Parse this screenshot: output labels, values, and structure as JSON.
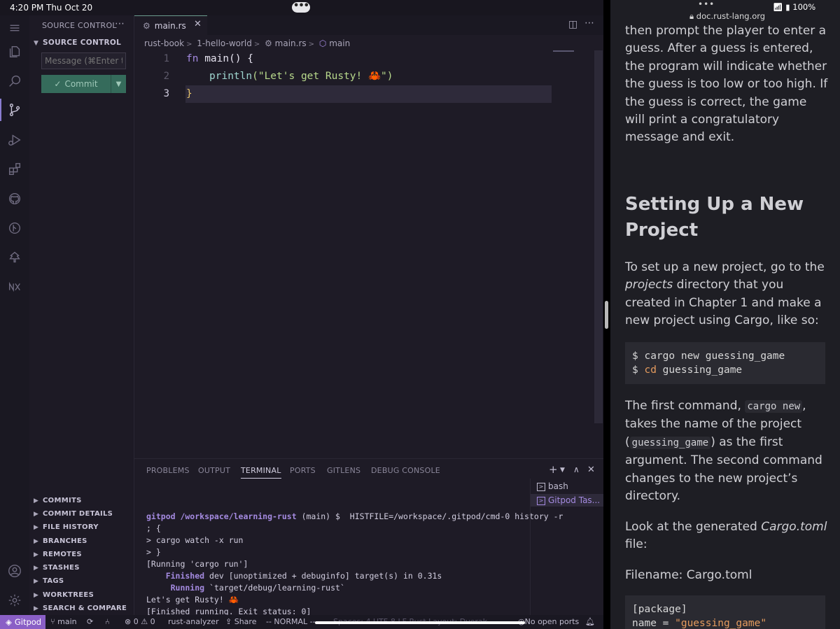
{
  "ipad": {
    "time": "4:20 PM",
    "date": "Thu Oct 20",
    "battery": "100%"
  },
  "sidebar": {
    "title": "SOURCE CONTROL",
    "more": "⋯",
    "section_header": "SOURCE CONTROL",
    "message_placeholder": "Message (⌘Enter t...",
    "commit_label": "Commit",
    "sections": [
      "COMMITS",
      "COMMIT DETAILS",
      "FILE HISTORY",
      "BRANCHES",
      "REMOTES",
      "STASHES",
      "TAGS",
      "WORKTREES",
      "SEARCH & COMPARE"
    ]
  },
  "editor": {
    "tab_label": "main.rs",
    "breadcrumb": [
      "rust-book",
      "1-hello-world",
      "main.rs",
      "main"
    ],
    "lines": [
      {
        "num": "1",
        "kw": "fn",
        "rest": " main() {"
      },
      {
        "num": "2",
        "macro": "println",
        "str": "(\"Let's get Rusty! 🦀\")"
      },
      {
        "num": "3",
        "text": "}"
      }
    ]
  },
  "panel": {
    "tabs": [
      "PROBLEMS",
      "OUTPUT",
      "TERMINAL",
      "PORTS",
      "GITLENS",
      "DEBUG CONSOLE"
    ],
    "active_tab": "TERMINAL",
    "terminal_lines": [
      {
        "path": "gitpod /workspace/learning-rust",
        "rest": " (main) $  HISTFILE=/workspace/.gitpod/cmd-0 history -r"
      },
      {
        "text": "; {"
      },
      {
        "text": "> cargo watch -x run"
      },
      {
        "text": "> }"
      },
      {
        "text": "[Running 'cargo run']"
      },
      {
        "lead": "    Finished",
        "rest": " dev [unoptimized + debuginfo] target(s) in 0.31s"
      },
      {
        "lead": "     Running",
        "rest": " `target/debug/learning-rust`"
      },
      {
        "text": "Let's get Rusty! 🦀"
      },
      {
        "text": "[Finished running. Exit status: 0]"
      }
    ],
    "terminals": [
      "bash",
      "Gitpod Tas..."
    ]
  },
  "status_bar": {
    "gitpod": "Gitpod",
    "branch": "main",
    "problems": "0",
    "warnings": "0",
    "analyzer": "rust-analyzer",
    "share": "Share",
    "mode": "-- NORMAL --",
    "hidden": "Spaces: 4   UTF-8   LF   Rust   Layout: Dvorak",
    "ports": "No open ports"
  },
  "browser": {
    "url": "doc.rust-lang.org",
    "para1": "then prompt the player to enter a guess. After a guess is entered, the program will indicate whether the guess is too low or too high. If the guess is correct, the game will print a congratulatory message and exit.",
    "heading": "Setting Up a New Project",
    "para2_a": "To set up a new project, go to the ",
    "para2_em": "projects",
    "para2_b": " directory that you created in Chapter 1 and make a new project using Cargo, like so:",
    "code1_l1_cmd": "$ cargo new guessing_game",
    "code1_l2_a": "$ ",
    "code1_l2_cd": "cd",
    "code1_l2_b": " guessing_game",
    "para3_a": "The first command, ",
    "para3_code1": "cargo new",
    "para3_b": ", takes the name of the project (",
    "para3_code2": "guessing_game",
    "para3_c": ") as the first argument. The second command changes to the new project’s directory.",
    "para4_a": "Look at the generated ",
    "para4_em": "Cargo.toml",
    "para4_b": " file:",
    "filename": "Filename: Cargo.toml",
    "toml_l1": "[package]",
    "toml_l2_a": "name = ",
    "toml_l2_str": "\"guessing_game\""
  }
}
